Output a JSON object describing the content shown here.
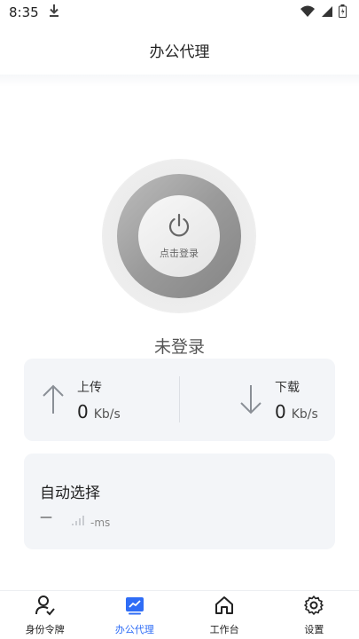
{
  "status_bar": {
    "time": "8:35",
    "icons": [
      "download-icon",
      "wifi-icon",
      "signal-icon",
      "battery-icon"
    ]
  },
  "header": {
    "title": "办公代理"
  },
  "power": {
    "button_label": "点击登录",
    "status_text": "未登录"
  },
  "speed": {
    "upload": {
      "label": "上传",
      "value": "0",
      "unit": "Kb/s"
    },
    "download": {
      "label": "下载",
      "value": "0",
      "unit": "Kb/s"
    }
  },
  "auto_select": {
    "title": "自动选择",
    "dash": "—",
    "latency": "-ms"
  },
  "tabbar": {
    "items": [
      {
        "label": "身份令牌",
        "icon": "user-check-icon"
      },
      {
        "label": "办公代理",
        "icon": "trend-chart-icon"
      },
      {
        "label": "工作台",
        "icon": "home-icon"
      },
      {
        "label": "设置",
        "icon": "gear-icon"
      }
    ],
    "active_index": 1
  },
  "colors": {
    "accent": "#2f6df6",
    "card_bg": "#f3f5f8"
  }
}
